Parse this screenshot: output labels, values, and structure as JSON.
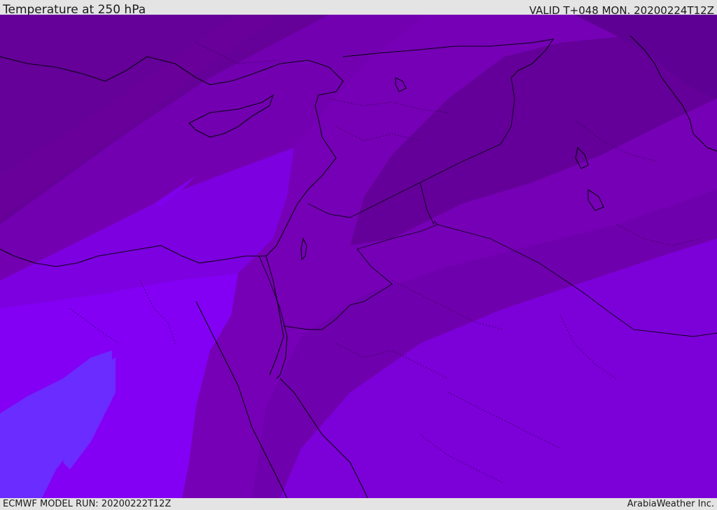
{
  "header": {
    "title": "Temperature at 250 hPa",
    "valid": "VALID T+048 MON. 20200224T12Z"
  },
  "footer": {
    "model_run": "ECMWF MODEL RUN: 20200222T12Z",
    "credit": "ArabiaWeather Inc."
  },
  "map": {
    "field": "temperature",
    "level": "250 hPa",
    "region": "Eastern Mediterranean / Levant",
    "shading_colors": [
      "#620099",
      "#6d00a8",
      "#7600b6",
      "#7c00cf",
      "#8000ef",
      "#8a00ff",
      "#6a2cff"
    ],
    "coastline_color": "#0a0014",
    "border_style": "dotted"
  }
}
